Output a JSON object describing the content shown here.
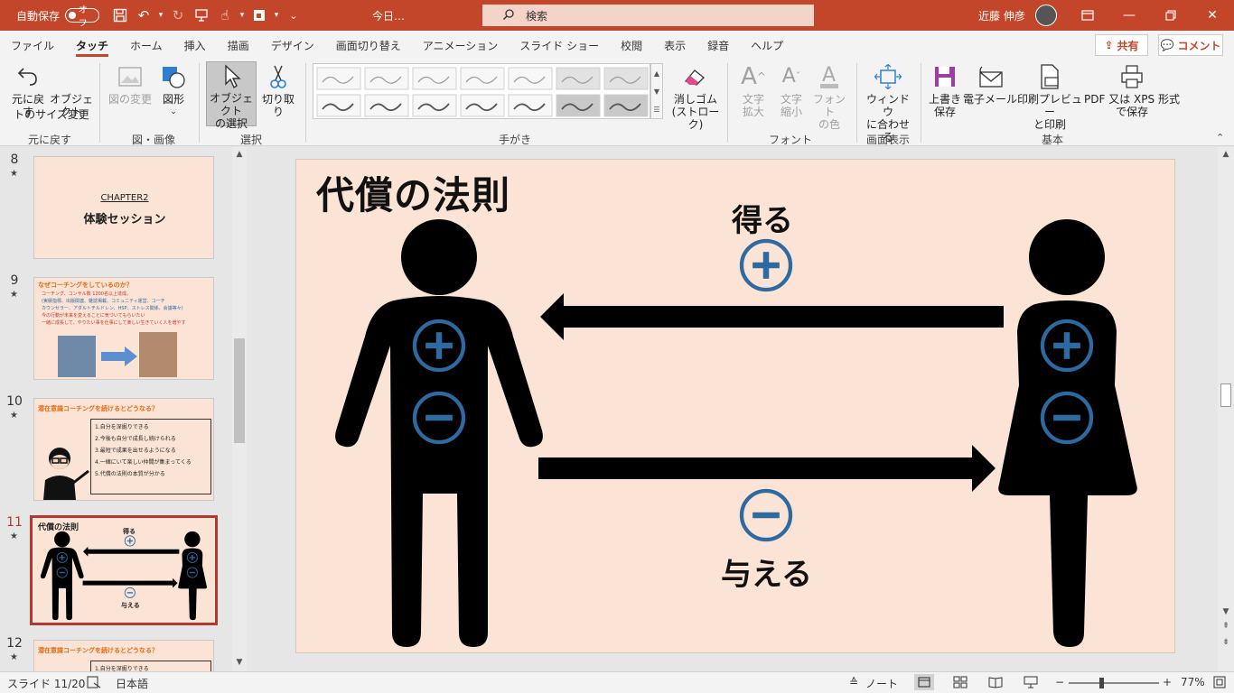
{
  "titlebar": {
    "autosave_label": "自動保存",
    "autosave_toggle": "オフ",
    "doc_title": "今日…",
    "search_placeholder": "検索",
    "user_name": "近藤 伸彦"
  },
  "tabs": [
    "ファイル",
    "タッチ",
    "ホーム",
    "挿入",
    "描画",
    "デザイン",
    "画面切り替え",
    "アニメーション",
    "スライド ショー",
    "校閲",
    "表示",
    "録音",
    "ヘルプ"
  ],
  "active_tab": "タッチ",
  "share_label": "共有",
  "comment_label": "コメント",
  "ribbon": {
    "undo_line1": "元に戻す",
    "resize_line1": "オブジェクト",
    "resize_line2": "トのサイズ変更",
    "group_undo": "元に戻す",
    "change_image": "図の変更",
    "shapes": "図形",
    "group_image": "図・画像",
    "select_line1": "オブジェクト",
    "select_line2": "の選択",
    "cut": "切り取り",
    "group_select": "選択",
    "group_ink": "手がき",
    "eraser_line1": "消しゴム",
    "eraser_line2": "(ストローク)",
    "grow_line1": "文字",
    "grow_line2": "拡大",
    "shrink_line1": "文字",
    "shrink_line2": "縮小",
    "fontcolor_line1": "フォント",
    "fontcolor_line2": "の色",
    "group_font": "フォント",
    "fit_line1": "ウィンドウ",
    "fit_line2": "に合わせる",
    "group_view": "画面表示",
    "save_line1": "上書き",
    "save_line2": "保存",
    "email": "電子メール",
    "print_line1": "印刷プレビュー",
    "print_line2": "と印刷",
    "pdf_line1": "PDF 又は XPS 形式",
    "pdf_line2": "で保存",
    "group_basic": "基本"
  },
  "thumbnails": [
    {
      "num": "8",
      "chapter": "CHAPTER2",
      "title": "体験セッション"
    },
    {
      "num": "9",
      "heading": "なぜコーチングをしているのか？",
      "lines": [
        "コーチング、コンサル数 1200名以上達成。",
        "(実績指標、出版関連、雑誌掲載、コミュニティ運営、コーチ",
        "カウンセラー、アダルトチルドレン、HSP、ストレス関係、会議等々)",
        "今の行動が未来を変えることに気づいてもらいたい",
        "一緒に成長して、やりたい事を仕事にして楽しい生きていく人を増やす"
      ]
    },
    {
      "num": "10",
      "heading": "潜在意識コーチングを続けるとどうなる？",
      "items": [
        "1.自分を深掘りできる",
        "2.今後も自分で成長し続けられる",
        "3.最短で成果を出せるようになる",
        "4.一緒にいて楽しい仲間が集まってくる",
        "5.代償の法則の本質が分かる"
      ]
    },
    {
      "num": "11",
      "title": "代償の法則",
      "get": "得る",
      "give": "与える"
    },
    {
      "num": "12",
      "heading": "潜在意識コーチングを続けるとどうなる？",
      "items": [
        "1.自分を深掘りできる"
      ]
    }
  ],
  "slide": {
    "title": "代償の法則",
    "get_label": "得る",
    "give_label": "与える"
  },
  "status": {
    "slide_count": "スライド 11/20",
    "language": "日本語",
    "notes": "ノート",
    "zoom": "77%"
  },
  "colors": {
    "titlebar": "#c4462a",
    "slide_bg": "#fbe4d5",
    "symbol_blue": "#2e6aa2",
    "selected_thumb": "#b03a2e"
  }
}
